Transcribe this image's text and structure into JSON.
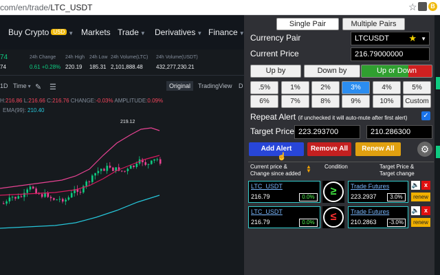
{
  "browser": {
    "url_prefix": "com/en/trade/",
    "url_pair": "LTC_USDT",
    "ext_label": "B"
  },
  "nav": {
    "buy_crypto": "Buy Crypto",
    "usd_badge": "USD",
    "markets": "Markets",
    "trade": "Trade",
    "derivatives": "Derivatives",
    "finance": "Finance"
  },
  "stats": {
    "price_partial": "74",
    "price_sub_partial": "74",
    "change_label": "24h Change",
    "change_value": "0.61 +0.28%",
    "high_label": "24h High",
    "high_value": "220.19",
    "low_label": "24h Low",
    "low_value": "185.31",
    "vol_ltc_label": "24h Volume(LTC)",
    "vol_ltc_value": "2,101,888.48",
    "vol_usdt_label": "24h Volume(USDT)",
    "vol_usdt_value": "432,277,230.21"
  },
  "chart_toolbar": {
    "interval": "1D",
    "time": "Time",
    "original": "Original",
    "tradingview": "TradingView",
    "depth_partial": "D"
  },
  "ohlc": {
    "h_label": "H:",
    "h_value": "216.86",
    "l_label": "L:",
    "l_value": "216.66",
    "c_label": "C:",
    "c_value": "216.76",
    "change_label": "CHANGE:",
    "change_value": "-0.03%",
    "amp_label": "AMPLITUDE:",
    "amp_value": "0.09%"
  },
  "ema": {
    "label": "EMA(99):",
    "value": "210.40"
  },
  "chart": {
    "peak_label": "219.12"
  },
  "panel": {
    "single_pair": "Single Pair",
    "multiple_pairs": "Multiple Pairs",
    "currency_pair_label": "Currency Pair",
    "currency_pair_value": "LTCUSDT",
    "current_price_label": "Current Price",
    "current_price_value": "216.79000000",
    "up_by": "Up by",
    "down_by": "Down by",
    "up_or_down": "Up or Down",
    "percents": [
      ".5%",
      "1%",
      "2%",
      "3%",
      "4%",
      "5%",
      "6%",
      "7%",
      "8%",
      "9%",
      "10%",
      "Custom"
    ],
    "repeat_label": "Repeat Alert",
    "repeat_hint": "(if unchecked it will auto-mute after first alert)",
    "target_label": "Target Price",
    "target_up": "223.293700",
    "target_down": "210.286300",
    "add_alert": "Add Alert",
    "remove_all": "Remove All",
    "renew_all": "Renew All",
    "col_current_1": "Current price &",
    "col_current_2": "Change since added",
    "col_condition": "Condition",
    "col_target_1": "Target Price &",
    "col_target_2": "Target change",
    "alerts": [
      {
        "pair": "LTC_USDT",
        "price": "216.79",
        "change": "0.0%",
        "condition": "≥",
        "link": "Trade Futures",
        "target": "223.2937",
        "target_change": "3.0%",
        "renew": "renew"
      },
      {
        "pair": "LTC_USDT",
        "price": "216.79",
        "change": "0.0%",
        "condition": "≤",
        "link": "Trade Futures",
        "target": "210.2863",
        "target_change": "-3.0%",
        "renew": "renew"
      }
    ]
  }
}
